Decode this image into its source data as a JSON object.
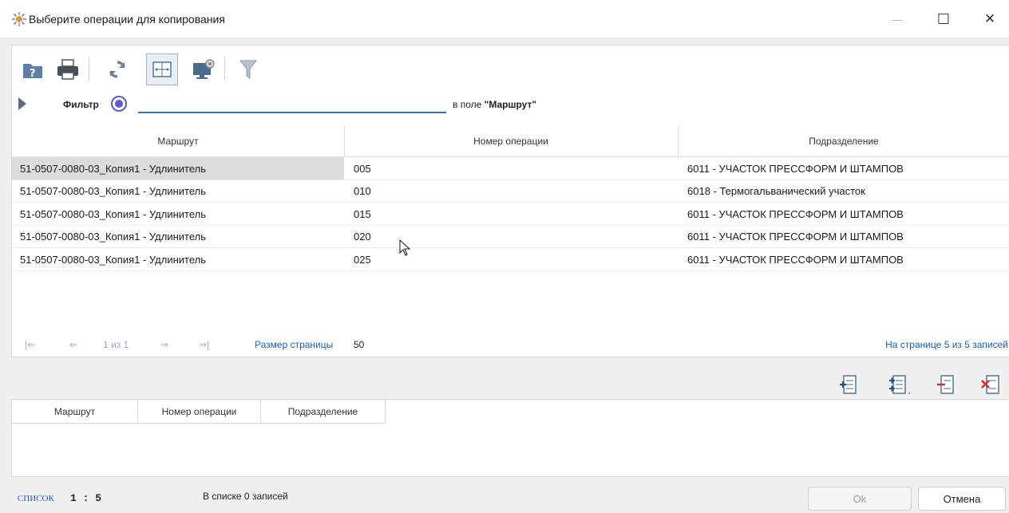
{
  "window": {
    "title": "Выберите операции для копирования",
    "min_glyph": "—",
    "max_glyph": "☐",
    "close_glyph": "✕"
  },
  "toolbar": {
    "icons": [
      "help-folder-icon",
      "print-icon",
      "refresh-icon",
      "fit-columns-icon",
      "settings-monitor-icon",
      "filter-icon"
    ]
  },
  "filter": {
    "label": "Фильтр",
    "value": "",
    "field_prefix": "в поле",
    "field_name": "\"Маршрут\""
  },
  "grid": {
    "columns": [
      "Маршрут",
      "Номер операции",
      "Подразделение"
    ],
    "rows": [
      {
        "route": "51-0507-0080-03_Копия1 - Удлинитель",
        "op": "005",
        "dept": "6011 - УЧАСТОК ПРЕССФОРМ И ШТАМПОВ"
      },
      {
        "route": "51-0507-0080-03_Копия1 - Удлинитель",
        "op": "010",
        "dept": "6018 - Термогальванический участок"
      },
      {
        "route": "51-0507-0080-03_Копия1 - Удлинитель",
        "op": "015",
        "dept": "6011 - УЧАСТОК ПРЕССФОРМ И ШТАМПОВ"
      },
      {
        "route": "51-0507-0080-03_Копия1 - Удлинитель",
        "op": "020",
        "dept": "6011 - УЧАСТОК ПРЕССФОРМ И ШТАМПОВ"
      },
      {
        "route": "51-0507-0080-03_Копия1 - Удлинитель",
        "op": "025",
        "dept": "6011 - УЧАСТОК ПРЕССФОРМ И ШТАМПОВ"
      }
    ]
  },
  "pager": {
    "first": "|⇐",
    "prev": "⇐",
    "position": "1 из 1",
    "next": "⇒",
    "last": "⇒|",
    "page_size_label": "Размер страницы",
    "page_size": "50",
    "count_text": "На странице 5 из 5 записей"
  },
  "lower_grid": {
    "columns": [
      "Маршрут",
      "Номер операции",
      "Подразделение"
    ]
  },
  "status": {
    "list_label": "СПИСОК",
    "ratio": "1 : 5",
    "count_text": "В списке 0 записей"
  },
  "buttons": {
    "ok": "Ok",
    "cancel": "Отмена"
  }
}
